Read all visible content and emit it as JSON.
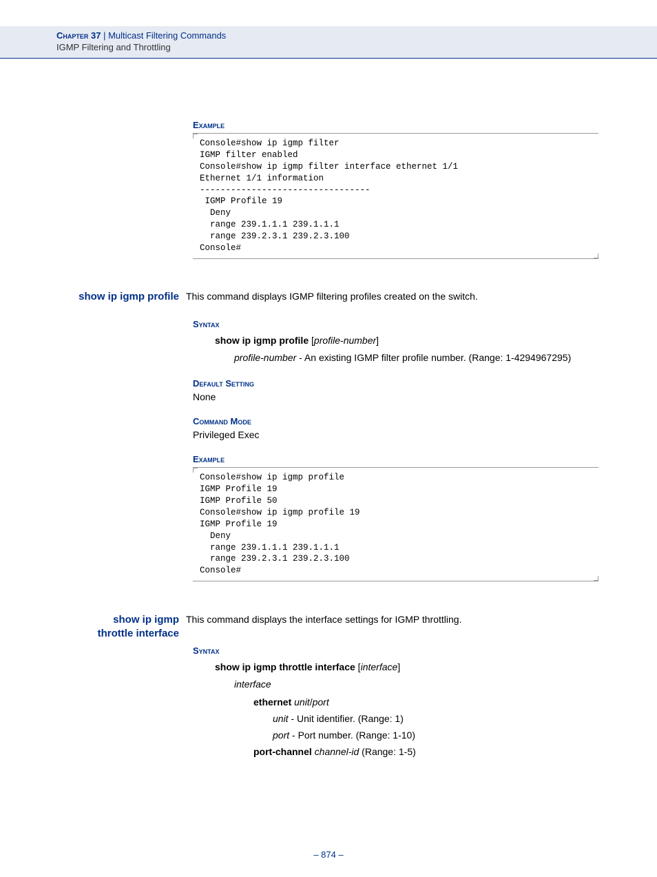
{
  "header": {
    "chapter_label": "Chapter 37",
    "chapter_sep": "  |  ",
    "chapter_title": "Multicast Filtering Commands",
    "subtitle": "IGMP Filtering and Throttling"
  },
  "sec1": {
    "heading_example": "Example",
    "code": "Console#show ip igmp filter\nIGMP filter enabled\nConsole#show ip igmp filter interface ethernet 1/1\nEthernet 1/1 information\n---------------------------------\n IGMP Profile 19\n  Deny\n  range 239.1.1.1 239.1.1.1\n  range 239.2.3.1 239.2.3.100\nConsole#"
  },
  "cmd_profile": {
    "name": "show ip igmp profile",
    "desc": "This command displays IGMP filtering profiles created on the switch.",
    "heading_syntax": "Syntax",
    "syntax_cmd": "show ip igmp profile",
    "syntax_bracket_open": " [",
    "syntax_param": "profile-number",
    "syntax_bracket_close": "]",
    "param_name": "profile-number",
    "param_desc": " - An existing IGMP filter profile number. (Range: 1-4294967295)",
    "heading_default": "Default Setting",
    "default_text": "None",
    "heading_mode": "Command Mode",
    "mode_text": "Privileged Exec",
    "heading_example": "Example",
    "code": "Console#show ip igmp profile\nIGMP Profile 19\nIGMP Profile 50\nConsole#show ip igmp profile 19\nIGMP Profile 19\n  Deny\n  range 239.1.1.1 239.1.1.1\n  range 239.2.3.1 239.2.3.100\nConsole#"
  },
  "cmd_throttle": {
    "name_line1": "show ip igmp",
    "name_line2": "throttle interface",
    "desc": "This command displays the interface settings for IGMP throttling.",
    "heading_syntax": "Syntax",
    "syntax_cmd": "show ip igmp throttle interface",
    "syntax_bracket_open": " [",
    "syntax_param": "interface",
    "syntax_bracket_close": "]",
    "iface_label": "interface",
    "eth_label": "ethernet",
    "eth_sep": " ",
    "eth_unit": "unit",
    "eth_slash": "/",
    "eth_port": "port",
    "unit_name": "unit",
    "unit_desc": " - Unit identifier. (Range: 1)",
    "port_name": "port",
    "port_desc": " - Port number. (Range: 1-10)",
    "pc_label": "port-channel",
    "pc_sep": " ",
    "pc_param": "channel-id",
    "pc_desc": " (Range: 1-5)"
  },
  "footer": {
    "page": "– 874 –"
  }
}
